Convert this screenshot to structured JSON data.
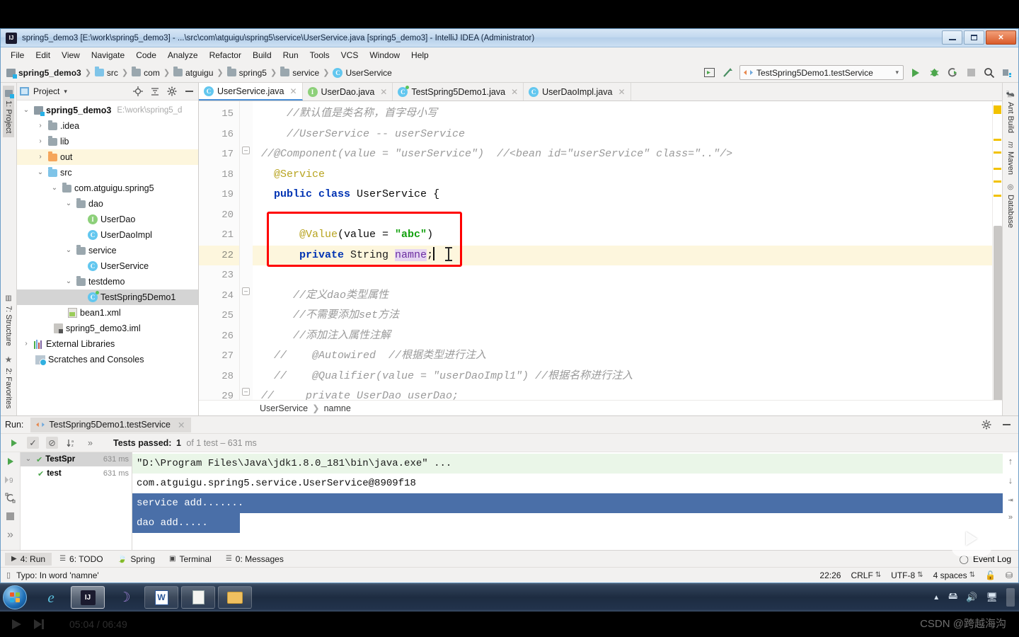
{
  "window": {
    "title": "spring5_demo3 [E:\\work\\spring5_demo3] - ...\\src\\com\\atguigu\\spring5\\service\\UserService.java [spring5_demo3] - IntelliJ IDEA (Administrator)",
    "app_icon": "intellij-idea-icon",
    "buttons": {
      "minimize": "minimize-icon",
      "maximize": "maximize-icon",
      "close": "close-icon"
    }
  },
  "menubar": {
    "items": [
      "File",
      "Edit",
      "View",
      "Navigate",
      "Code",
      "Analyze",
      "Refactor",
      "Build",
      "Run",
      "Tools",
      "VCS",
      "Window",
      "Help"
    ]
  },
  "navbar": {
    "breadcrumbs": [
      {
        "label": "spring5_demo3",
        "icon": "module-icon",
        "bold": true
      },
      {
        "label": "src",
        "icon": "source-folder-icon",
        "bold": false
      },
      {
        "label": "com",
        "icon": "package-icon",
        "bold": false
      },
      {
        "label": "atguigu",
        "icon": "package-icon",
        "bold": false
      },
      {
        "label": "spring5",
        "icon": "package-icon",
        "bold": false
      },
      {
        "label": "service",
        "icon": "package-icon",
        "bold": false
      },
      {
        "label": "UserService",
        "icon": "class-icon",
        "bold": false
      }
    ],
    "run_configuration": "TestSpring5Demo1.testService",
    "actions": [
      "restore-layout-icon",
      "build-icon",
      "run-icon",
      "debug-icon",
      "run-coverage-icon",
      "stop-icon",
      "search-icon",
      "project-structure-icon"
    ]
  },
  "left_strip": {
    "top": [
      {
        "label": "1: Project",
        "icon": "project-icon",
        "selected": true
      }
    ],
    "bottom": [
      {
        "label": "7: Structure",
        "icon": "structure-icon"
      },
      {
        "label": "2: Favorites",
        "icon": "star-icon"
      }
    ]
  },
  "right_strip": {
    "items": [
      {
        "label": "Ant Build",
        "icon": "ant-icon"
      },
      {
        "label": "Maven",
        "icon": "maven-icon"
      },
      {
        "label": "Database",
        "icon": "database-icon"
      }
    ]
  },
  "project_pane": {
    "title": "Project",
    "header_icons": [
      "locate-icon",
      "collapse-all-icon",
      "gear-icon",
      "hide-icon"
    ],
    "tree": [
      {
        "label": "spring5_demo3",
        "path": "E:\\work\\spring5_d",
        "indent": 0,
        "arrow": "down",
        "icon": "module-icon",
        "bold": true,
        "state": ""
      },
      {
        "label": ".idea",
        "indent": 1,
        "arrow": "right",
        "icon": "folder-gray-icon",
        "bold": false,
        "state": ""
      },
      {
        "label": "lib",
        "indent": 1,
        "arrow": "right",
        "icon": "folder-gray-icon",
        "bold": false,
        "state": ""
      },
      {
        "label": "out",
        "indent": 1,
        "arrow": "right",
        "icon": "folder-orange-icon",
        "bold": false,
        "state": "highlight"
      },
      {
        "label": "src",
        "indent": 1,
        "arrow": "down",
        "icon": "source-folder-icon",
        "bold": false,
        "state": ""
      },
      {
        "label": "com.atguigu.spring5",
        "indent": 2,
        "arrow": "down",
        "icon": "package-icon",
        "bold": false,
        "state": ""
      },
      {
        "label": "dao",
        "indent": 3,
        "arrow": "down",
        "icon": "package-icon",
        "bold": false,
        "state": ""
      },
      {
        "label": "UserDao",
        "indent": 4,
        "arrow": "none",
        "icon": "interface-icon",
        "bold": false,
        "state": ""
      },
      {
        "label": "UserDaoImpl",
        "indent": 4,
        "arrow": "none",
        "icon": "class-icon",
        "bold": false,
        "state": ""
      },
      {
        "label": "service",
        "indent": 3,
        "arrow": "down",
        "icon": "package-icon",
        "bold": false,
        "state": ""
      },
      {
        "label": "UserService",
        "indent": 4,
        "arrow": "none",
        "icon": "class-icon",
        "bold": false,
        "state": ""
      },
      {
        "label": "testdemo",
        "indent": 3,
        "arrow": "down",
        "icon": "package-icon",
        "bold": false,
        "state": ""
      },
      {
        "label": "TestSpring5Demo1",
        "indent": 4,
        "arrow": "none",
        "icon": "test-class-icon",
        "bold": false,
        "state": "selected"
      },
      {
        "label": "bean1.xml",
        "indent": 2,
        "arrow": "none",
        "icon": "xml-file-icon",
        "bold": false,
        "state": ""
      },
      {
        "label": "spring5_demo3.iml",
        "indent": 1,
        "arrow": "none",
        "icon": "iml-file-icon",
        "bold": false,
        "state": ""
      },
      {
        "label": "External Libraries",
        "indent": 0,
        "arrow": "right",
        "icon": "libraries-icon",
        "bold": false,
        "state": ""
      },
      {
        "label": "Scratches and Consoles",
        "indent": 0,
        "arrow": "none",
        "icon": "scratches-icon",
        "bold": false,
        "state": ""
      }
    ]
  },
  "editor": {
    "tabs": [
      {
        "label": "UserService.java",
        "icon": "class-icon",
        "active": true
      },
      {
        "label": "UserDao.java",
        "icon": "interface-icon",
        "active": false
      },
      {
        "label": "TestSpring5Demo1.java",
        "icon": "test-class-icon",
        "active": false
      },
      {
        "label": "UserDaoImpl.java",
        "icon": "class-icon",
        "active": false
      }
    ],
    "first_line_number": 15,
    "current_line_number": 22,
    "lines": [
      {
        "no": 15,
        "segments": [
          {
            "t": "    //默认值是类名称，首字母小写",
            "c": "cmt"
          }
        ]
      },
      {
        "no": 16,
        "segments": [
          {
            "t": "    //UserService -- userService",
            "c": "cmt"
          }
        ]
      },
      {
        "no": 17,
        "segments": [
          {
            "t": "//@Component(value = \"userService\")  //<bean id=\"userService\" class=\"..\"/>",
            "c": "cmt"
          }
        ],
        "fold": true
      },
      {
        "no": 18,
        "segments": [
          {
            "t": "  @Service",
            "c": "anno"
          }
        ]
      },
      {
        "no": 19,
        "segments": [
          {
            "t": "  public class ",
            "c": "kw"
          },
          {
            "t": "UserService ",
            "c": "plain"
          },
          {
            "t": "{",
            "c": "plain"
          }
        ]
      },
      {
        "no": 20,
        "segments": [
          {
            "t": "",
            "c": "plain"
          }
        ]
      },
      {
        "no": 21,
        "segments": [
          {
            "t": "      @Value",
            "c": "anno"
          },
          {
            "t": "(value = ",
            "c": "plain"
          },
          {
            "t": "\"abc\"",
            "c": "str"
          },
          {
            "t": ")",
            "c": "plain"
          }
        ]
      },
      {
        "no": 22,
        "segments": [
          {
            "t": "      private ",
            "c": "kw"
          },
          {
            "t": "String ",
            "c": "type-txt"
          },
          {
            "t": "namne",
            "c": "field-sel"
          },
          {
            "t": ";",
            "c": "plain"
          }
        ],
        "current": true,
        "caret": true
      },
      {
        "no": 23,
        "segments": [
          {
            "t": "",
            "c": "plain"
          }
        ]
      },
      {
        "no": 24,
        "segments": [
          {
            "t": "     //定义dao类型属性",
            "c": "cmt"
          }
        ],
        "fold": true
      },
      {
        "no": 25,
        "segments": [
          {
            "t": "     //不需要添加set方法",
            "c": "cmt"
          }
        ]
      },
      {
        "no": 26,
        "segments": [
          {
            "t": "     //添加注入属性注解",
            "c": "cmt"
          }
        ]
      },
      {
        "no": 27,
        "segments": [
          {
            "t": "  //    @Autowired  //根据类型进行注入",
            "c": "cmt"
          }
        ]
      },
      {
        "no": 28,
        "segments": [
          {
            "t": "  //    @Qualifier(value = \"userDaoImpl1\") //根据名称进行注入",
            "c": "cmt"
          }
        ]
      },
      {
        "no": 29,
        "segments": [
          {
            "t": "//     private UserDao userDao;",
            "c": "cmt"
          }
        ],
        "fold": true
      }
    ],
    "breadcrumb": [
      "UserService",
      "namne"
    ],
    "annotation": {
      "type": "red-rectangle",
      "color": "#ff0000"
    }
  },
  "run_panel": {
    "label": "Run:",
    "tab": "TestSpring5Demo1.testService",
    "toolbar_icons": [
      "rerun-icon",
      "check-icon",
      "ignore-icon",
      "sort-alpha-icon",
      "expand-icon"
    ],
    "status": {
      "prefix": "Tests passed:",
      "count": "1",
      "detail": "of 1 test – 631 ms"
    },
    "side_icons": [
      "rerun-icon",
      "rerun-failed-icon",
      "toggle-auto-test-icon",
      "stop-icon",
      "more-icon"
    ],
    "tests_tree": [
      {
        "label": "TestSpr",
        "duration": "631 ms",
        "indent": 0,
        "selected": true
      },
      {
        "label": "test",
        "duration": "631 ms",
        "indent": 1,
        "selected": false
      }
    ],
    "console_lines": [
      {
        "text": "\"D:\\Program Files\\Java\\jdk1.8.0_181\\bin\\java.exe\" ...",
        "style": "cmd"
      },
      {
        "text": "com.atguigu.spring5.service.UserService@8909f18",
        "style": "plain"
      },
      {
        "text": "service add.......",
        "style": "sel"
      },
      {
        "text": "dao add.....",
        "style": "sel-partial"
      }
    ],
    "console_right_icons": [
      "scroll-up-icon",
      "scroll-down-icon",
      "soft-wrap-icon",
      "more-icon"
    ],
    "header_icons": [
      "gear-icon",
      "hide-icon"
    ]
  },
  "tool_tabs": {
    "items": [
      {
        "label": "4: Run",
        "icon": "run-icon",
        "active": true
      },
      {
        "label": "6: TODO",
        "icon": "todo-icon",
        "active": false
      },
      {
        "label": "Spring",
        "icon": "spring-leaf-icon",
        "active": false
      },
      {
        "label": "Terminal",
        "icon": "terminal-icon",
        "active": false
      },
      {
        "label": "0: Messages",
        "icon": "messages-icon",
        "active": false
      }
    ],
    "event_log": "Event Log"
  },
  "statusbar": {
    "message": "Typo: In word 'namne'",
    "position": "22:26",
    "line_separator": "CRLF",
    "encoding": "UTF-8",
    "indent": "4 spaces",
    "icons": [
      "lock-icon",
      "git-branch-icon"
    ]
  },
  "taskbar": {
    "items": [
      {
        "name": "start-orb",
        "label": ""
      },
      {
        "name": "internet-explorer-icon",
        "label": ""
      },
      {
        "name": "intellij-idea-icon",
        "label": ""
      },
      {
        "name": "media-player-icon",
        "label": ""
      },
      {
        "name": "word-icon",
        "label": ""
      },
      {
        "name": "notepad-icon",
        "label": ""
      },
      {
        "name": "file-explorer-icon",
        "label": ""
      }
    ],
    "tray": [
      "show-hidden-icons",
      "flash-drive-icon",
      "volume-icon",
      "network-icon"
    ]
  },
  "video_player": {
    "time": "05:04 / 06:49",
    "play_icon": "play-icon",
    "next_icon": "next-icon"
  },
  "watermark": "CSDN @跨越海沟"
}
